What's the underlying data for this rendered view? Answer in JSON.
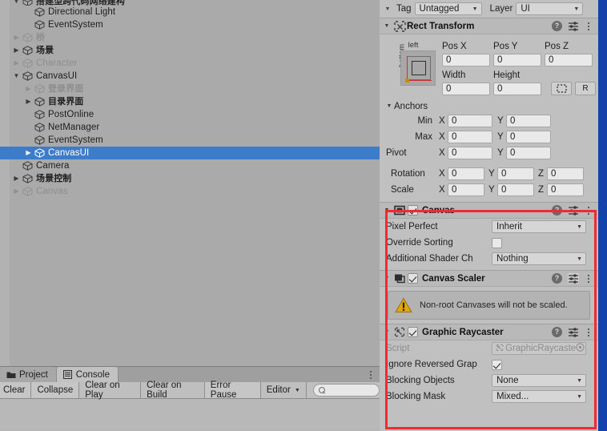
{
  "hierarchy": {
    "items": [
      {
        "label": "搭建型跨代码网络建构",
        "indent": 1,
        "twisty": "down",
        "state": "clipped",
        "cn": true
      },
      {
        "label": "Directional Light",
        "indent": 2,
        "twisty": "none",
        "state": "normal",
        "cn": false
      },
      {
        "label": "EventSystem",
        "indent": 2,
        "twisty": "none",
        "state": "normal",
        "cn": false
      },
      {
        "label": "桥",
        "indent": 1,
        "twisty": "right",
        "state": "dim",
        "cn": true
      },
      {
        "label": "场景",
        "indent": 1,
        "twisty": "right",
        "state": "normal",
        "cn": true
      },
      {
        "label": "Character",
        "indent": 1,
        "twisty": "right",
        "state": "dim",
        "cn": false
      },
      {
        "label": "CanvasUI",
        "indent": 1,
        "twisty": "down",
        "state": "normal",
        "cn": false
      },
      {
        "label": "登录界面",
        "indent": 2,
        "twisty": "right",
        "state": "dim",
        "cn": true
      },
      {
        "label": "目录界面",
        "indent": 2,
        "twisty": "right",
        "state": "normal",
        "cn": true
      },
      {
        "label": "PostOnline",
        "indent": 2,
        "twisty": "none",
        "state": "normal",
        "cn": false
      },
      {
        "label": "NetManager",
        "indent": 2,
        "twisty": "none",
        "state": "normal",
        "cn": false
      },
      {
        "label": "EventSystem",
        "indent": 2,
        "twisty": "none",
        "state": "normal",
        "cn": false
      },
      {
        "label": "CanvasUI",
        "indent": 2,
        "twisty": "right",
        "state": "selected",
        "cn": false
      },
      {
        "label": "Camera",
        "indent": 1,
        "twisty": "none",
        "state": "normal",
        "cn": false
      },
      {
        "label": "场景控制",
        "indent": 1,
        "twisty": "right",
        "state": "normal",
        "cn": true
      },
      {
        "label": "Canvas",
        "indent": 1,
        "twisty": "right",
        "state": "dim",
        "cn": false
      }
    ]
  },
  "bottom_panel": {
    "tabs": [
      {
        "label": "Project",
        "icon": "folder-icon",
        "active": false
      },
      {
        "label": "Console",
        "icon": "console-icon",
        "active": true
      }
    ],
    "toolbar": {
      "clear": "Clear",
      "collapse": "Collapse",
      "clear_on_play": "Clear on Play",
      "clear_on_build": "Clear on Build",
      "error_pause": "Error Pause",
      "editor": "Editor",
      "search_placeholder": ""
    }
  },
  "inspector": {
    "tag_label": "Tag",
    "tag_value": "Untagged",
    "layer_label": "Layer",
    "layer_value": "UI",
    "rect_transform": {
      "title": "Rect Transform",
      "anchor_preset_top": "left",
      "anchor_preset_left": "bottom",
      "pos_x_label": "Pos X",
      "pos_y_label": "Pos Y",
      "pos_z_label": "Pos Z",
      "pos_x": "0",
      "pos_y": "0",
      "pos_z": "0",
      "width_label": "Width",
      "height_label": "Height",
      "width": "0",
      "height": "0",
      "blueprint_label": "",
      "raw_label": "R",
      "anchors_label": "Anchors",
      "min_label": "Min",
      "min_x": "0",
      "min_y": "0",
      "max_label": "Max",
      "max_x": "0",
      "max_y": "0",
      "pivot_label": "Pivot",
      "pivot_x": "0",
      "pivot_y": "0",
      "rotation_label": "Rotation",
      "rotation_x": "0",
      "rotation_y": "0",
      "rotation_z": "0",
      "scale_label": "Scale",
      "scale_x": "0",
      "scale_y": "0",
      "scale_z": "0",
      "axis_x": "X",
      "axis_y": "Y",
      "axis_z": "Z"
    },
    "canvas": {
      "title": "Canvas",
      "enabled": true,
      "pixel_perfect_label": "Pixel Perfect",
      "pixel_perfect_value": "Inherit",
      "override_sorting_label": "Override Sorting",
      "override_sorting_value": false,
      "additional_shader_label": "Additional Shader Ch",
      "additional_shader_value": "Nothing"
    },
    "canvas_scaler": {
      "title": "Canvas Scaler",
      "enabled": true,
      "warning": "Non-root Canvases will not be scaled."
    },
    "graphic_raycaster": {
      "title": "Graphic Raycaster",
      "enabled": true,
      "script_label": "Script",
      "script_value": "GraphicRaycaste",
      "ignore_reversed_label": "Ignore Reversed Grap",
      "ignore_reversed_value": true,
      "blocking_objects_label": "Blocking Objects",
      "blocking_objects_value": "None",
      "blocking_mask_label": "Blocking Mask",
      "blocking_mask_value": "Mixed..."
    }
  },
  "colors": {
    "highlight_red": "#f4282f",
    "selection_blue": "#3d7cc9",
    "right_strip_blue": "#1342ab",
    "warning_yellow": "#e0a80d",
    "panel_bg": "#c0c0c0",
    "hierarchy_bg": "#aaaaaa"
  }
}
